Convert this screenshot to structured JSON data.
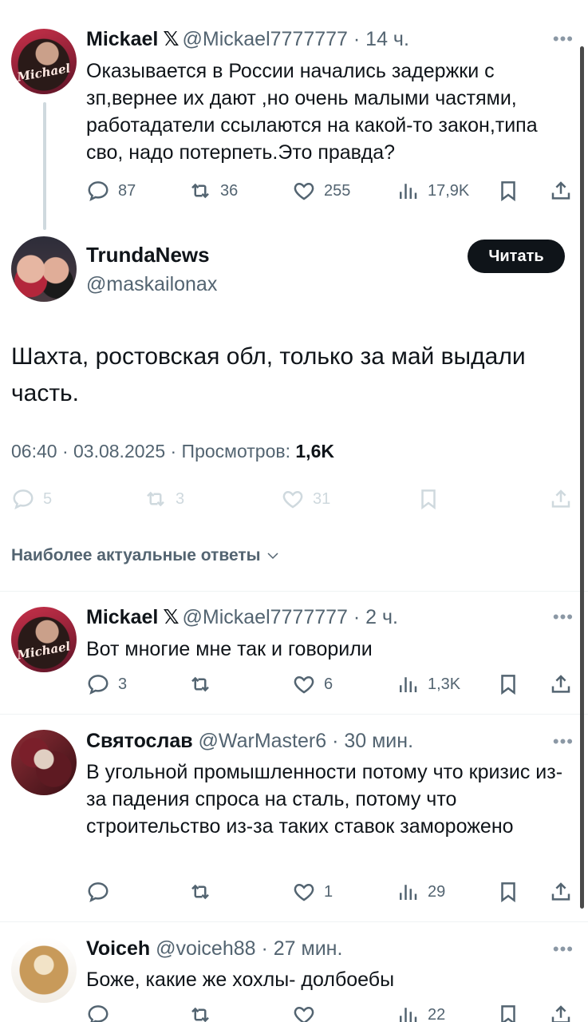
{
  "tweet1": {
    "name": "Mickael",
    "badge": "𝕏",
    "handle": "@Mickael7777777",
    "time": "· 14 ч.",
    "text": "Оказывается в России начались задержки с зп,вернее их дают ,но очень малыми частями, работадатели ссылаются на какой-то закон,типа сво, надо потерпеть.Это правда?",
    "replies": "87",
    "reposts": "36",
    "likes": "255",
    "views": "17,9K",
    "avatar_text": "Michael"
  },
  "main": {
    "name": "TrundaNews",
    "handle": "@maskailonax",
    "follow_label": "Читать",
    "text": "Шахта, ростовская обл, только за май выдали часть.",
    "meta": "06:40 · 03.08.2025 · Просмотров: ",
    "views": "1,6K",
    "replies": "5",
    "reposts": "3",
    "likes": "31"
  },
  "sort_label": "Наиболее актуальные ответы",
  "replies": [
    {
      "name": "Mickael",
      "badge": "𝕏",
      "handle": "@Mickael7777777",
      "time": "· 2 ч.",
      "text": "Вот многие мне так и говорили",
      "replies": "3",
      "reposts": "",
      "likes": "6",
      "views": "1,3K",
      "avatar_text": "Michael"
    },
    {
      "name": "Святослав",
      "handle": "@WarMaster6",
      "time": "· 30 мин.",
      "text": "В угольной промышленности потому что кризис из-за падения спроса на сталь, потому что строительство из-за таких ставок заморожено",
      "replies": "",
      "reposts": "",
      "likes": "1",
      "views": "29"
    },
    {
      "name": "Voiceh",
      "handle": "@voiceh88",
      "time": "· 27 мин.",
      "text": "Боже, какие же хохлы- долбоебы",
      "views": "22"
    }
  ],
  "colors": {
    "text": "#0f1419",
    "secondary": "#536471",
    "faded": "#cfd9de",
    "button_bg": "#0f1419"
  }
}
